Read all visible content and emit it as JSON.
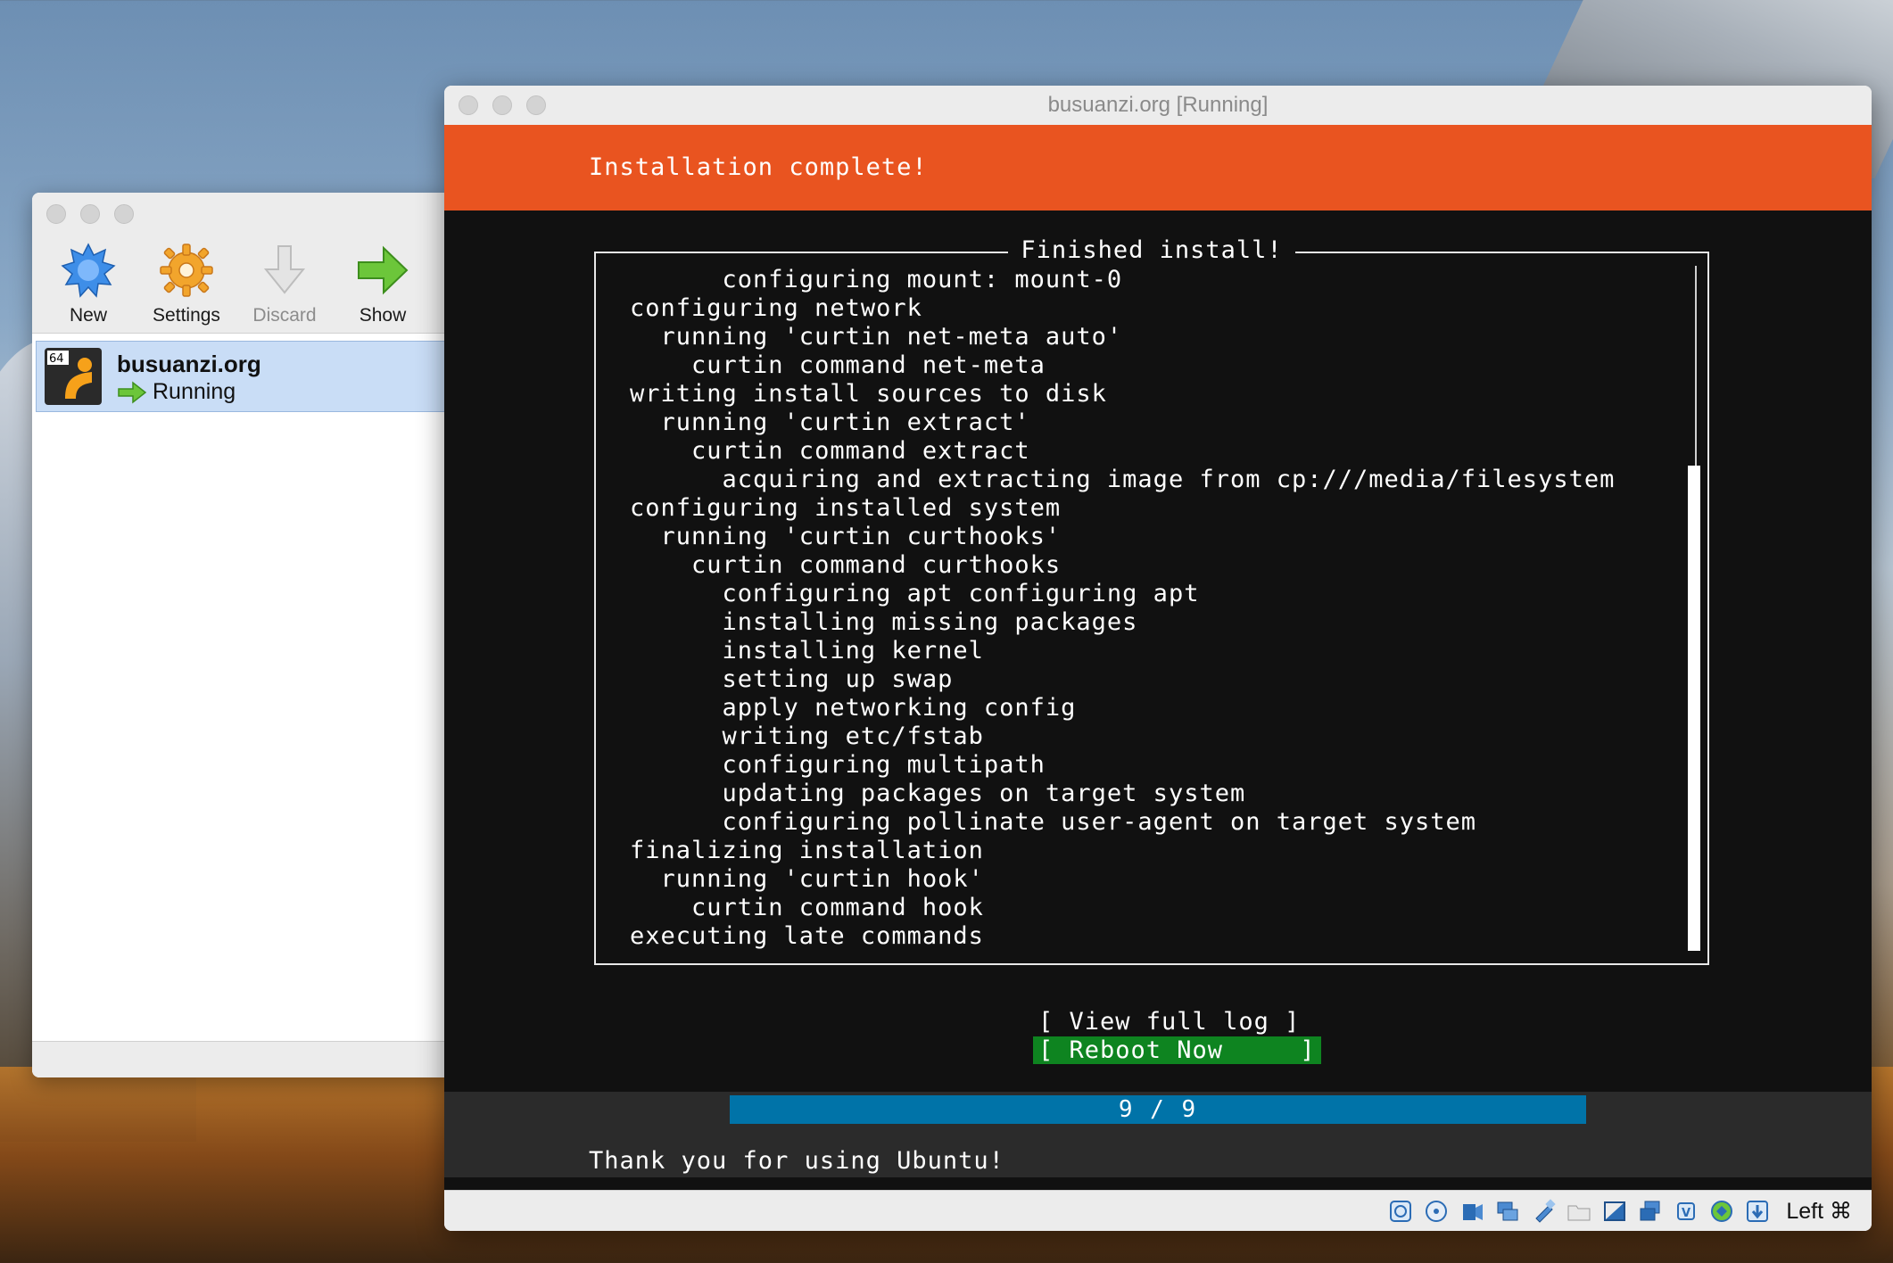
{
  "manager": {
    "toolbar": [
      {
        "label": "New",
        "icon": "new-vm-icon",
        "enabled": true
      },
      {
        "label": "Settings",
        "icon": "settings-gear-icon",
        "enabled": true
      },
      {
        "label": "Discard",
        "icon": "discard-arrow-icon",
        "enabled": false
      },
      {
        "label": "Show",
        "icon": "show-arrow-icon",
        "enabled": true
      }
    ],
    "vm_list": [
      {
        "badge": "64",
        "name": "busuanzi.org",
        "state": "Running"
      }
    ]
  },
  "vm_window": {
    "title": "busuanzi.org [Running]",
    "header": "Installation complete!",
    "frame_title": "Finished install!",
    "log_lines": [
      "      configuring mount: mount-0",
      "configuring network",
      "  running 'curtin net-meta auto'",
      "    curtin command net-meta",
      "writing install sources to disk",
      "  running 'curtin extract'",
      "    curtin command extract",
      "      acquiring and extracting image from cp:///media/filesystem",
      "configuring installed system",
      "  running 'curtin curthooks'",
      "    curtin command curthooks",
      "      configuring apt configuring apt",
      "      installing missing packages",
      "      installing kernel",
      "      setting up swap",
      "      apply networking config",
      "      writing etc/fstab",
      "      configuring multipath",
      "      updating packages on target system",
      "      configuring pollinate user-agent on target system",
      "finalizing installation",
      "  running 'curtin hook'",
      "    curtin command hook",
      "executing late commands"
    ],
    "buttons": {
      "view_log": "[ View full log ]",
      "reboot": "[ Reboot Now     ]"
    },
    "progress": {
      "label": "9 / 9",
      "current": 9,
      "total": 9
    },
    "footer": "Thank you for using Ubuntu!",
    "host_key": "Left ⌘",
    "status_icons": [
      "hard-disk-icon",
      "optical-disk-icon",
      "audio-icon",
      "network-icon",
      "usb-icon",
      "shared-folder-icon",
      "display-icon",
      "video-capture-icon",
      "cpu-icon",
      "mouse-integration-icon",
      "keyboard-capture-icon"
    ],
    "colors": {
      "ubuntu_orange": "#e95420",
      "selected_button": "#0e8420",
      "progress": "#0073a8"
    }
  }
}
